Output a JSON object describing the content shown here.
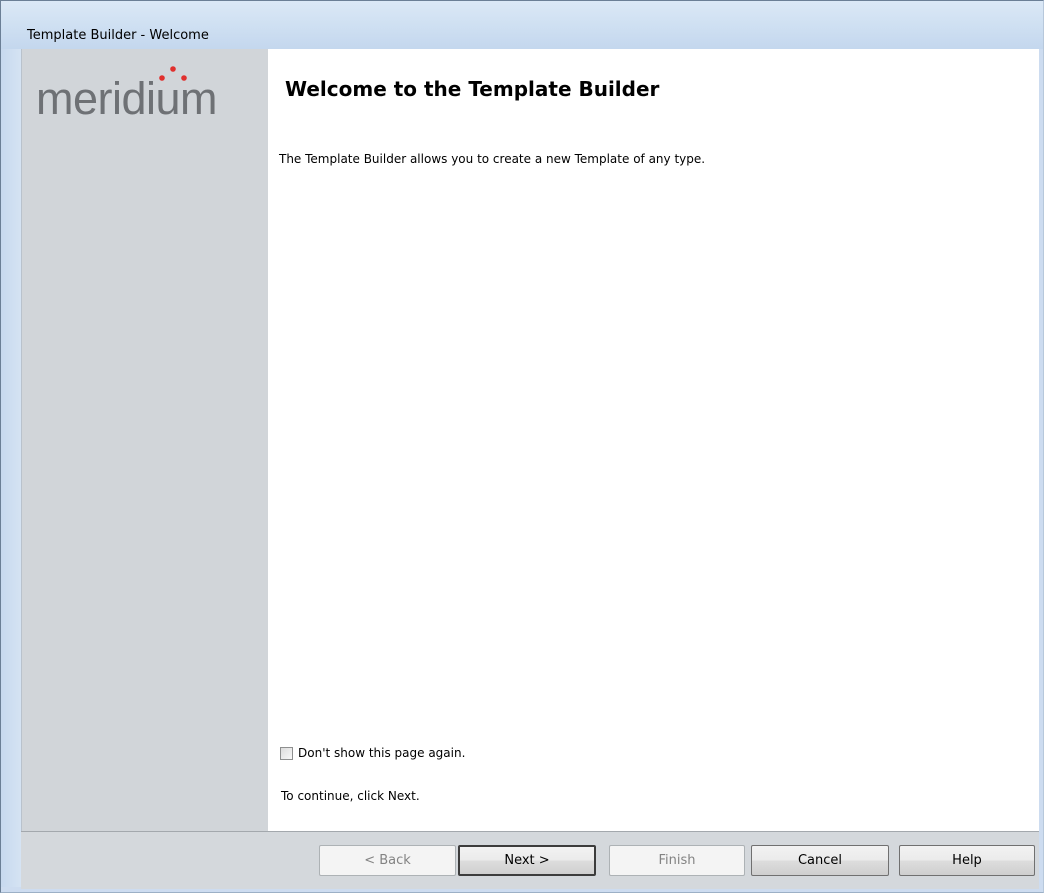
{
  "window": {
    "title": "Template Builder - Welcome"
  },
  "sidebar": {
    "logo_text": "meridium",
    "logo_icon": "meridium-logo"
  },
  "main": {
    "heading": "Welcome to the Template Builder",
    "description": "The Template Builder allows you to create a new Template of any type.",
    "dont_show_checkbox": {
      "label": "Don't show this page again.",
      "checked": false
    },
    "continue_text": "To continue, click Next."
  },
  "footer": {
    "back_label": "< Back",
    "next_label": "Next >",
    "finish_label": "Finish",
    "cancel_label": "Cancel",
    "help_label": "Help"
  },
  "colors": {
    "titlebar": "#cfe0f2",
    "sidebar": "#d1d5d9",
    "footer": "#d4d8dc",
    "logo_gray": "#6e7175",
    "logo_red": "#e0302e"
  }
}
